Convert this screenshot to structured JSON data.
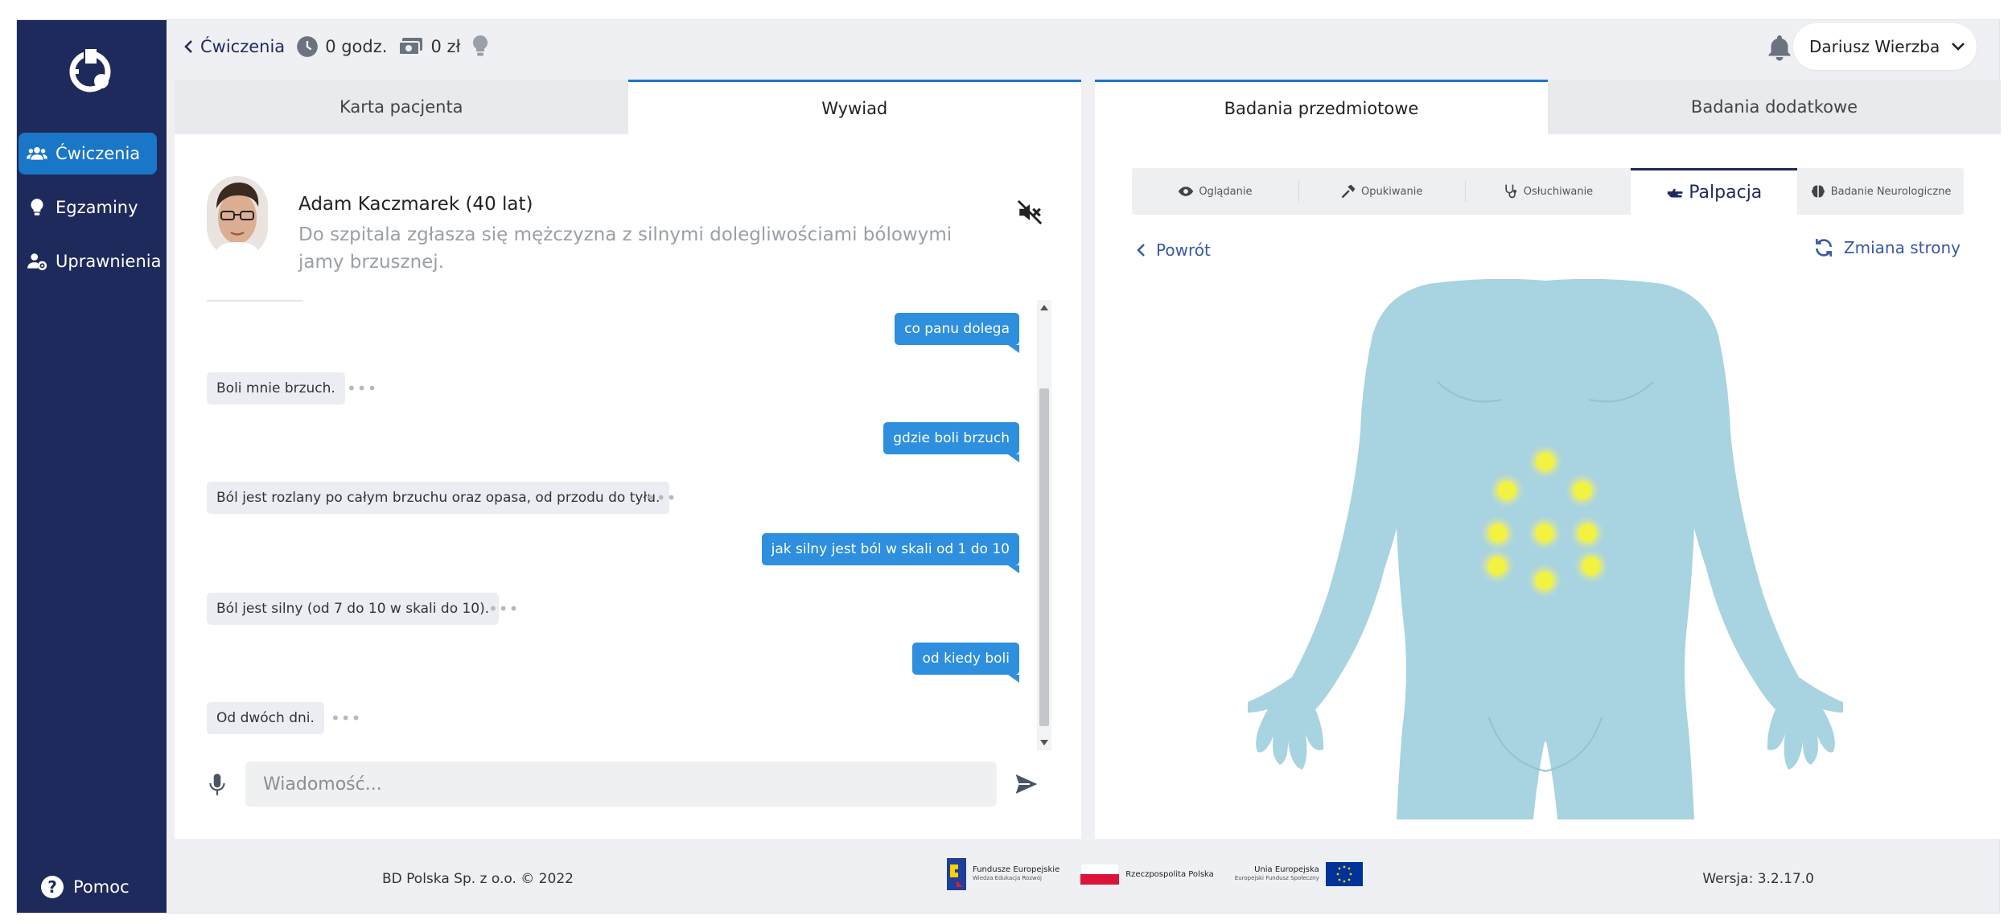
{
  "sidebar": {
    "items": [
      {
        "label": "Ćwiczenia",
        "icon": "users-icon",
        "active": true
      },
      {
        "label": "Egzaminy",
        "icon": "lightbulb-icon",
        "active": false
      },
      {
        "label": "Uprawnienia",
        "icon": "user-gear-icon",
        "active": false
      }
    ],
    "help_label": "Pomoc"
  },
  "topbar": {
    "back_label": "Ćwiczenia",
    "hours": "0 godz.",
    "money": "0 zł",
    "user_name": "Dariusz Wierzba"
  },
  "left_tabs": [
    {
      "label": "Karta pacjenta",
      "active": false
    },
    {
      "label": "Wywiad",
      "active": true
    }
  ],
  "patient": {
    "name": "Adam Kaczmarek (40 lat)",
    "description": "Do szpitala zgłasza się mężczyzna z silnymi dolegliwościami bólowymi jamy brzusznej."
  },
  "chat": {
    "messages": [
      {
        "side": "out",
        "text": "co panu dolega"
      },
      {
        "side": "in",
        "text": "Boli mnie brzuch."
      },
      {
        "side": "out",
        "text": "gdzie boli brzuch"
      },
      {
        "side": "in",
        "text": "Ból jest rozlany po całym brzuchu oraz opasa, od przodu do tyłu."
      },
      {
        "side": "out",
        "text": "jak silny jest ból w skali od 1 do 10"
      },
      {
        "side": "in",
        "text": "Ból jest silny (od 7 do 10 w skali do 10)."
      },
      {
        "side": "out",
        "text": "od kiedy boli"
      },
      {
        "side": "in",
        "text": "Od dwóch dni."
      }
    ],
    "dots": "•••",
    "input_placeholder": "Wiadomość..."
  },
  "right_tabs": [
    {
      "label": "Badania przedmiotowe",
      "active": true
    },
    {
      "label": "Badania dodatkowe",
      "active": false
    }
  ],
  "exam_tabs": [
    {
      "label": "Oglądanie",
      "icon": "eye-icon",
      "active": false
    },
    {
      "label": "Opukiwanie",
      "icon": "hammer-icon",
      "active": false
    },
    {
      "label": "Osłuchiwanie",
      "icon": "stethoscope-icon",
      "active": false
    },
    {
      "label": "Palpacja",
      "icon": "hand-icon",
      "active": true
    },
    {
      "label": "Badanie Neurologiczne",
      "icon": "brain-icon",
      "active": false
    }
  ],
  "exam_nav": {
    "back_label": "Powrót",
    "switch_label": "Zmiana strony"
  },
  "palpation_points_count": 9,
  "colors": {
    "sidebar": "#1f2a5c",
    "accent": "#1a76c6",
    "bubble_out": "#2d8fde",
    "body": "#a8d3e0",
    "point": "#f2f240"
  },
  "footer": {
    "copyright": "BD Polska Sp. z o.o. © 2022",
    "version": "Wersja: 3.2.17.0",
    "logo1": {
      "title": "Fundusze Europejskie",
      "sub": "Wiedza Edukacja Rozwój"
    },
    "logo2": {
      "title": "Rzeczpospolita Polska"
    },
    "logo3": {
      "title": "Unia Europejska",
      "sub": "Europejski Fundusz Społeczny"
    }
  }
}
